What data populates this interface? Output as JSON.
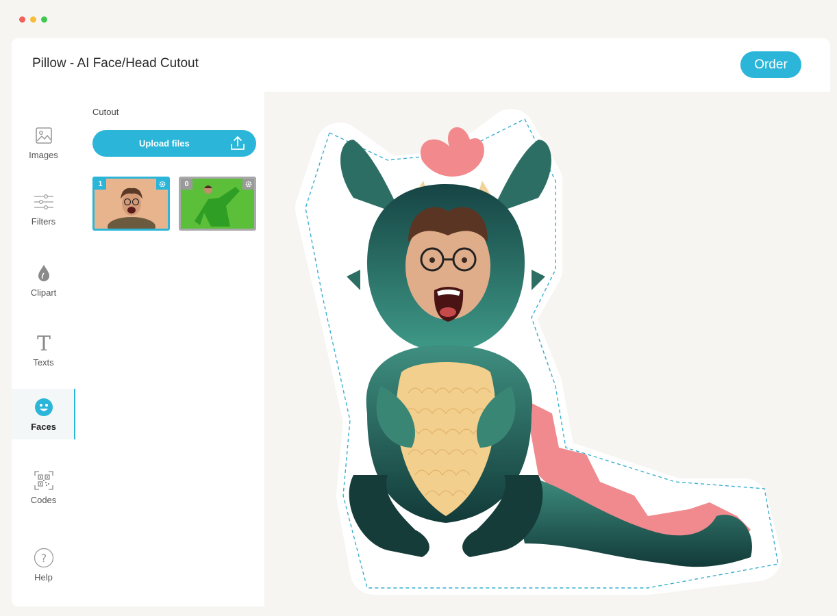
{
  "window": {
    "controls": [
      "close",
      "minimize",
      "maximize"
    ]
  },
  "header": {
    "title": "Pillow - AI Face/Head Cutout",
    "order_label": "Order"
  },
  "sidebar": {
    "items": [
      {
        "label": "Images",
        "icon": "image-icon"
      },
      {
        "label": "Filters",
        "icon": "sliders-icon"
      },
      {
        "label": "Clipart",
        "icon": "drop-icon"
      },
      {
        "label": "Texts",
        "icon": "text-icon"
      },
      {
        "label": "Faces",
        "icon": "smiley-icon",
        "active": true
      },
      {
        "label": "Codes",
        "icon": "qr-code-icon"
      },
      {
        "label": "Help",
        "icon": "help-icon"
      }
    ]
  },
  "panel": {
    "label": "Cutout",
    "upload_label": "Upload files",
    "thumbnails": [
      {
        "badge": "1",
        "selected": true,
        "description": "man with glasses shouting, beige background"
      },
      {
        "badge": "0",
        "selected": false,
        "description": "man in green jacket on green background"
      }
    ]
  },
  "colors": {
    "accent": "#2bb6d9",
    "background": "#f6f5f2"
  }
}
